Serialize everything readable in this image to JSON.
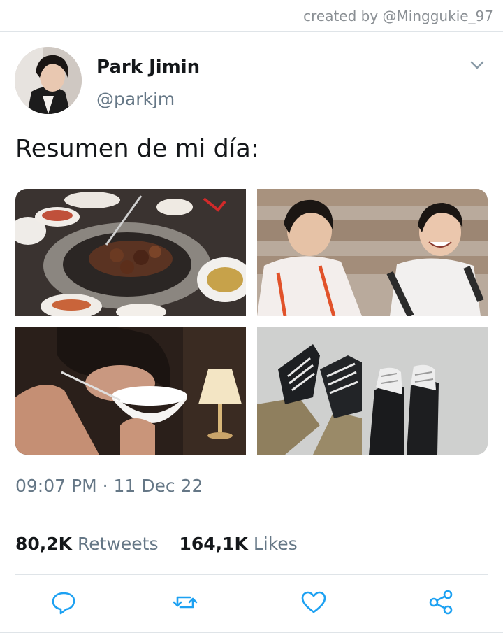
{
  "credit": "created by @Minggukie_97",
  "author": {
    "name": "Park Jimin",
    "handle": "@parkjm"
  },
  "tweet": {
    "text": "Resumen de mi día:"
  },
  "media": [
    {
      "icon": "photo-bbq-grill"
    },
    {
      "icon": "photo-two-people-laughing"
    },
    {
      "icon": "photo-person-eating-from-bowl"
    },
    {
      "icon": "photo-ice-skates"
    }
  ],
  "timestamp": "09:07 PM · 11 Dec 22",
  "stats": {
    "retweets_count": "80,2K",
    "retweets_label": "Retweets",
    "likes_count": "164,1K",
    "likes_label": "Likes"
  },
  "actions": [
    "reply-icon",
    "retweet-icon",
    "like-icon",
    "share-icon"
  ],
  "colors": {
    "text": "#14171a",
    "secondary": "#657786",
    "divider": "#dfe4e8",
    "icon": "#1da1f2"
  }
}
